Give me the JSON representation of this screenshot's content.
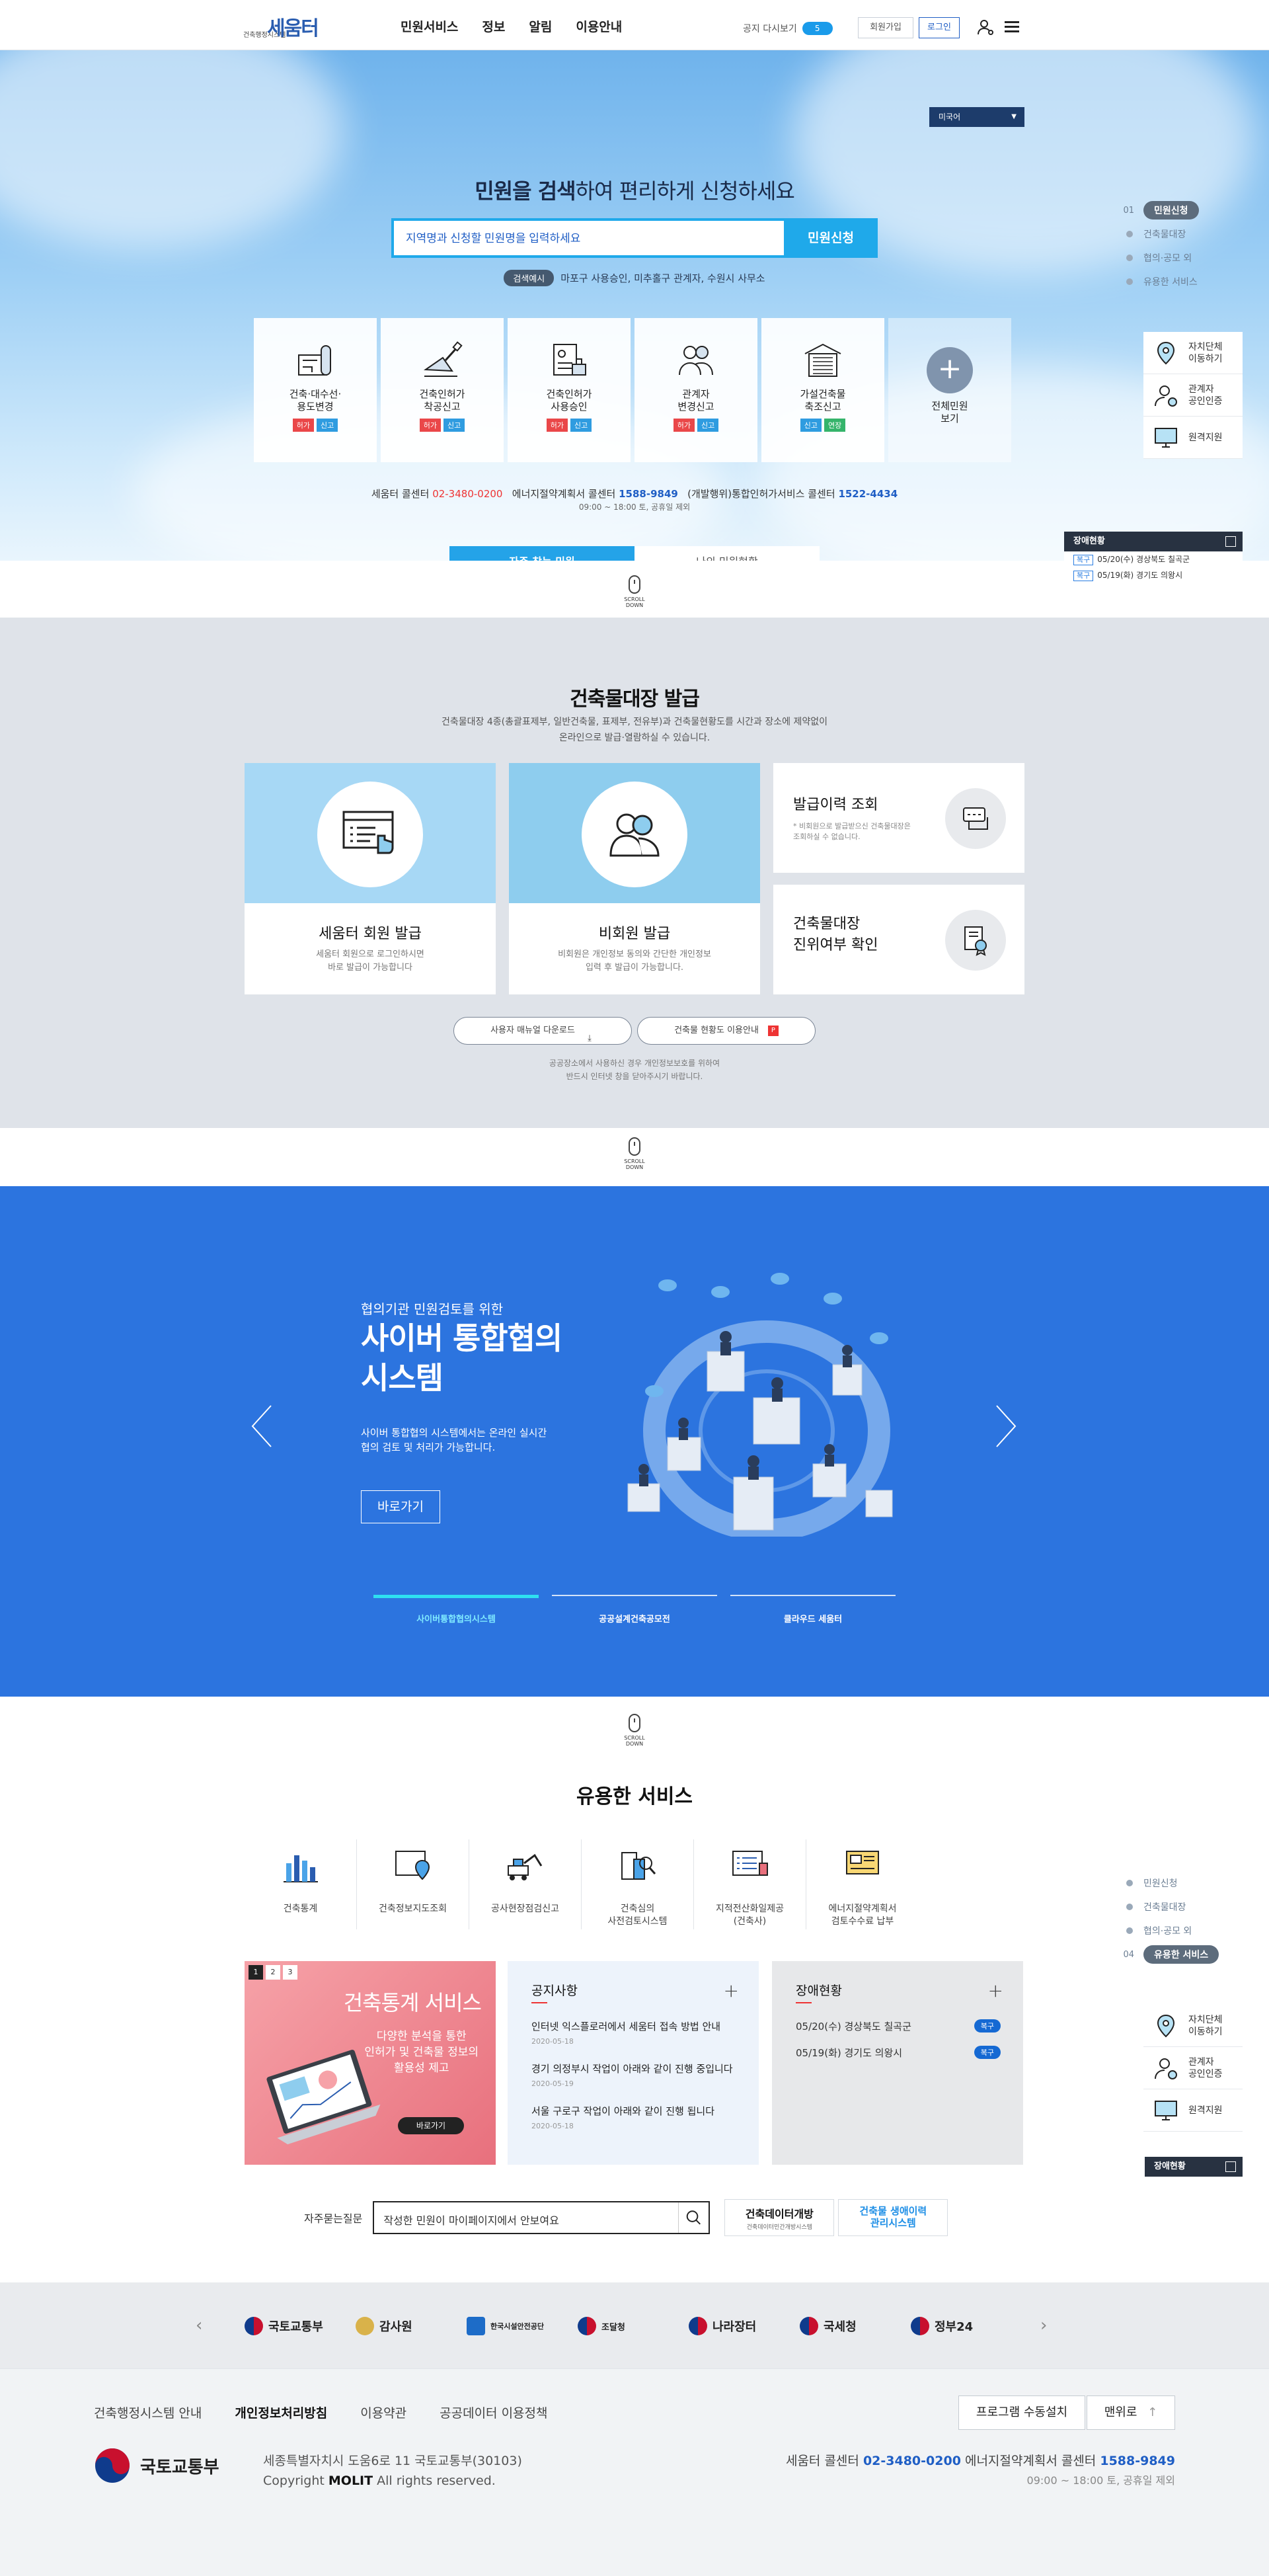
{
  "header": {
    "logo_small": "건축행정시스템",
    "logo_big": "세움터",
    "menu": [
      "민원서비스",
      "정보",
      "알림",
      "이용안내"
    ],
    "notice_label": "공지 다시보기",
    "notice_count": "5",
    "join_label": "회원가입",
    "login_label": "로그인"
  },
  "hero": {
    "lang": "미국어",
    "title_bold": "민원을 검색",
    "title_rest": "하여 편리하게 신청하세요",
    "search_placeholder": "지역명과 신청할 민원명을 입력하세요",
    "search_button": "민원신청",
    "example_tag": "검색예시",
    "example_text": "마포구 사용승인, 미추홀구 관계자, 수원시 사무소",
    "cards": [
      {
        "label": "건축·대수선·\n용도변경",
        "badges": [
          "허가",
          "신고"
        ]
      },
      {
        "label": "건축인허가\n착공신고",
        "badges": [
          "허가",
          "신고"
        ]
      },
      {
        "label": "건축인허가\n사용승인",
        "badges": [
          "허가",
          "신고"
        ]
      },
      {
        "label": "관계자\n변경신고",
        "badges": [
          "허가",
          "신고"
        ]
      },
      {
        "label": "가설건축물\n축조신고",
        "badges": [
          "신고",
          "연장"
        ]
      },
      {
        "label": "전체민원\n보기",
        "badges": []
      }
    ],
    "call_1_label": "세움터 콜센터",
    "call_1_num": "02-3480-0200",
    "call_2_label": "에너지절약계획서 콜센터",
    "call_2_num": "1588-9849",
    "call_3_label": "(개발행위)통합인허가서비스 콜센터",
    "call_3_num": "1522-4434",
    "call_hours": "09:00 ~ 18:00 토, 공휴일 제외",
    "tab_on": "자주 찾는 민원",
    "tab_off": "나의 민원현황"
  },
  "quick": {
    "steps": [
      {
        "num": "01",
        "label": "민원신청"
      },
      {
        "label": "건축물대장"
      },
      {
        "label": "협의·공모 외"
      },
      {
        "label": "유용한 서비스"
      }
    ],
    "steps_b": [
      {
        "label": "민원신청"
      },
      {
        "label": "건축물대장"
      },
      {
        "label": "협의·공모 외"
      },
      {
        "num": "04",
        "label": "유용한 서비스"
      }
    ],
    "links": [
      "자치단체\n이동하기",
      "관계자\n공인인증",
      "원격지원"
    ],
    "fault_title": "장애현황",
    "fault_items": [
      {
        "status": "복구",
        "text": "05/20(수) 경상북도 칠곡군"
      },
      {
        "status": "복구",
        "text": "05/19(화) 경기도 의왕시"
      }
    ]
  },
  "scroll_label": "SCROLL DOWN",
  "register": {
    "title": "건축물대장 발급",
    "desc_1": "건축물대장 4종(총괄표제부, 일반건축물, 표제부, 전유부)과 건축물현황도를 시간과 장소에 제약없이",
    "desc_2": "온라인으로 발급·열람하실 수 있습니다.",
    "card_member_title": "세움터 회원 발급",
    "card_member_desc_1": "세움터 회원으로 로그인하시면",
    "card_member_desc_2": "바로 발급이 가능합니다",
    "card_guest_title": "비회원 발급",
    "card_guest_desc_1": "비회원은 개인정보 동의와 간단한 개인정보",
    "card_guest_desc_2": "입력 후 발급이 가능합니다.",
    "history_title": "발급이력 조회",
    "history_desc_1": "* 비회원으로 발급받으신 건축물대장은",
    "history_desc_2": "조회하실 수 없습니다.",
    "verify_title_1": "건축물대장",
    "verify_title_2": "진위여부 확인",
    "manual_btn": "사용자 매뉴얼 다운로드",
    "guide_btn": "건축물 현황도 이용안내",
    "note_1": "공공장소에서 사용하신 경우 개인정보보호를 위하여",
    "note_2": "반드시 인터넷 창을 닫아주시기 바랍니다."
  },
  "cyber": {
    "pre": "협의기관 민원검토를 위한",
    "title_1": "사이버 통합협의",
    "title_2": "시스템",
    "desc": "사이버 통합협의 시스템에서는 온라인 실시간\n협의 검토 및 처리가 가능합니다.",
    "go": "바로가기",
    "tabs": [
      "사이버통합협의시스템",
      "공공설계건축공모전",
      "클라우드 세움터"
    ]
  },
  "useful": {
    "title": "유용한 서비스",
    "items": [
      "건축통계",
      "건축정보지도조회",
      "공사현장점검신고",
      "건축심의\n사전검토시스템",
      "지적전산화일제공\n(건축사)",
      "에너지절약계획서\n검토수수료 납부"
    ],
    "promo_pages": [
      "1",
      "2",
      "3"
    ],
    "promo_title": "건축통계 서비스",
    "promo_desc": "다양한 분석을 통한\n인허가 및 건축물 정보의\n활용성 제고",
    "promo_btn": "바로가기",
    "notice_title": "공지사항",
    "notices": [
      {
        "title": "인터넷 익스플로러에서 세움터 접속 방법 안내",
        "date": "2020-05-18"
      },
      {
        "title": "경기 의정부시 작업이 아래와 같이 진행 중입니다",
        "date": "2020-05-19"
      },
      {
        "title": "서울 구로구 작업이 아래와 같이 진행 됩니다",
        "date": "2020-05-18"
      }
    ],
    "fault_title": "장애현황",
    "faults": [
      {
        "text": "05/20(수) 경상북도 칠곡군",
        "status": "복구"
      },
      {
        "text": "05/19(화) 경기도 의왕시",
        "status": "복구"
      }
    ],
    "faq_label": "자주묻는질문",
    "faq_text": "작성한 민원이 마이페이지에서 안보여요",
    "banner1_title": "건축데이터개방",
    "banner1_sub": "건축데이터민간개방시스템",
    "banner2_title": "건축물 생애이력\n관리시스템"
  },
  "family": [
    "국토교통부",
    "감사원",
    "한국시설안전공단",
    "조달청",
    "나라장터",
    "국세청",
    "정부24"
  ],
  "footer": {
    "links": [
      "건축행정시스템 안내",
      "개인정보처리방침",
      "이용약관",
      "공공데이터 이용정책"
    ],
    "install_btn": "프로그램 수동설치",
    "top_btn": "맨위로",
    "logo": "국토교통부",
    "address": "세종특별자치시 도움6로 11 국토교통부(30103)",
    "copyright_pre": "Copyright",
    "copyright_org": "MOLIT",
    "copyright_post": "All rights reserved.",
    "call_label": "세움터 콜센터",
    "call_num_1": "02-3480-0200",
    "call_label_2": "에너지절약계획서 콜센터",
    "call_num_2": "1588-9849",
    "call_hours": "09:00 ~ 18:00 토, 공휴일 제외"
  }
}
